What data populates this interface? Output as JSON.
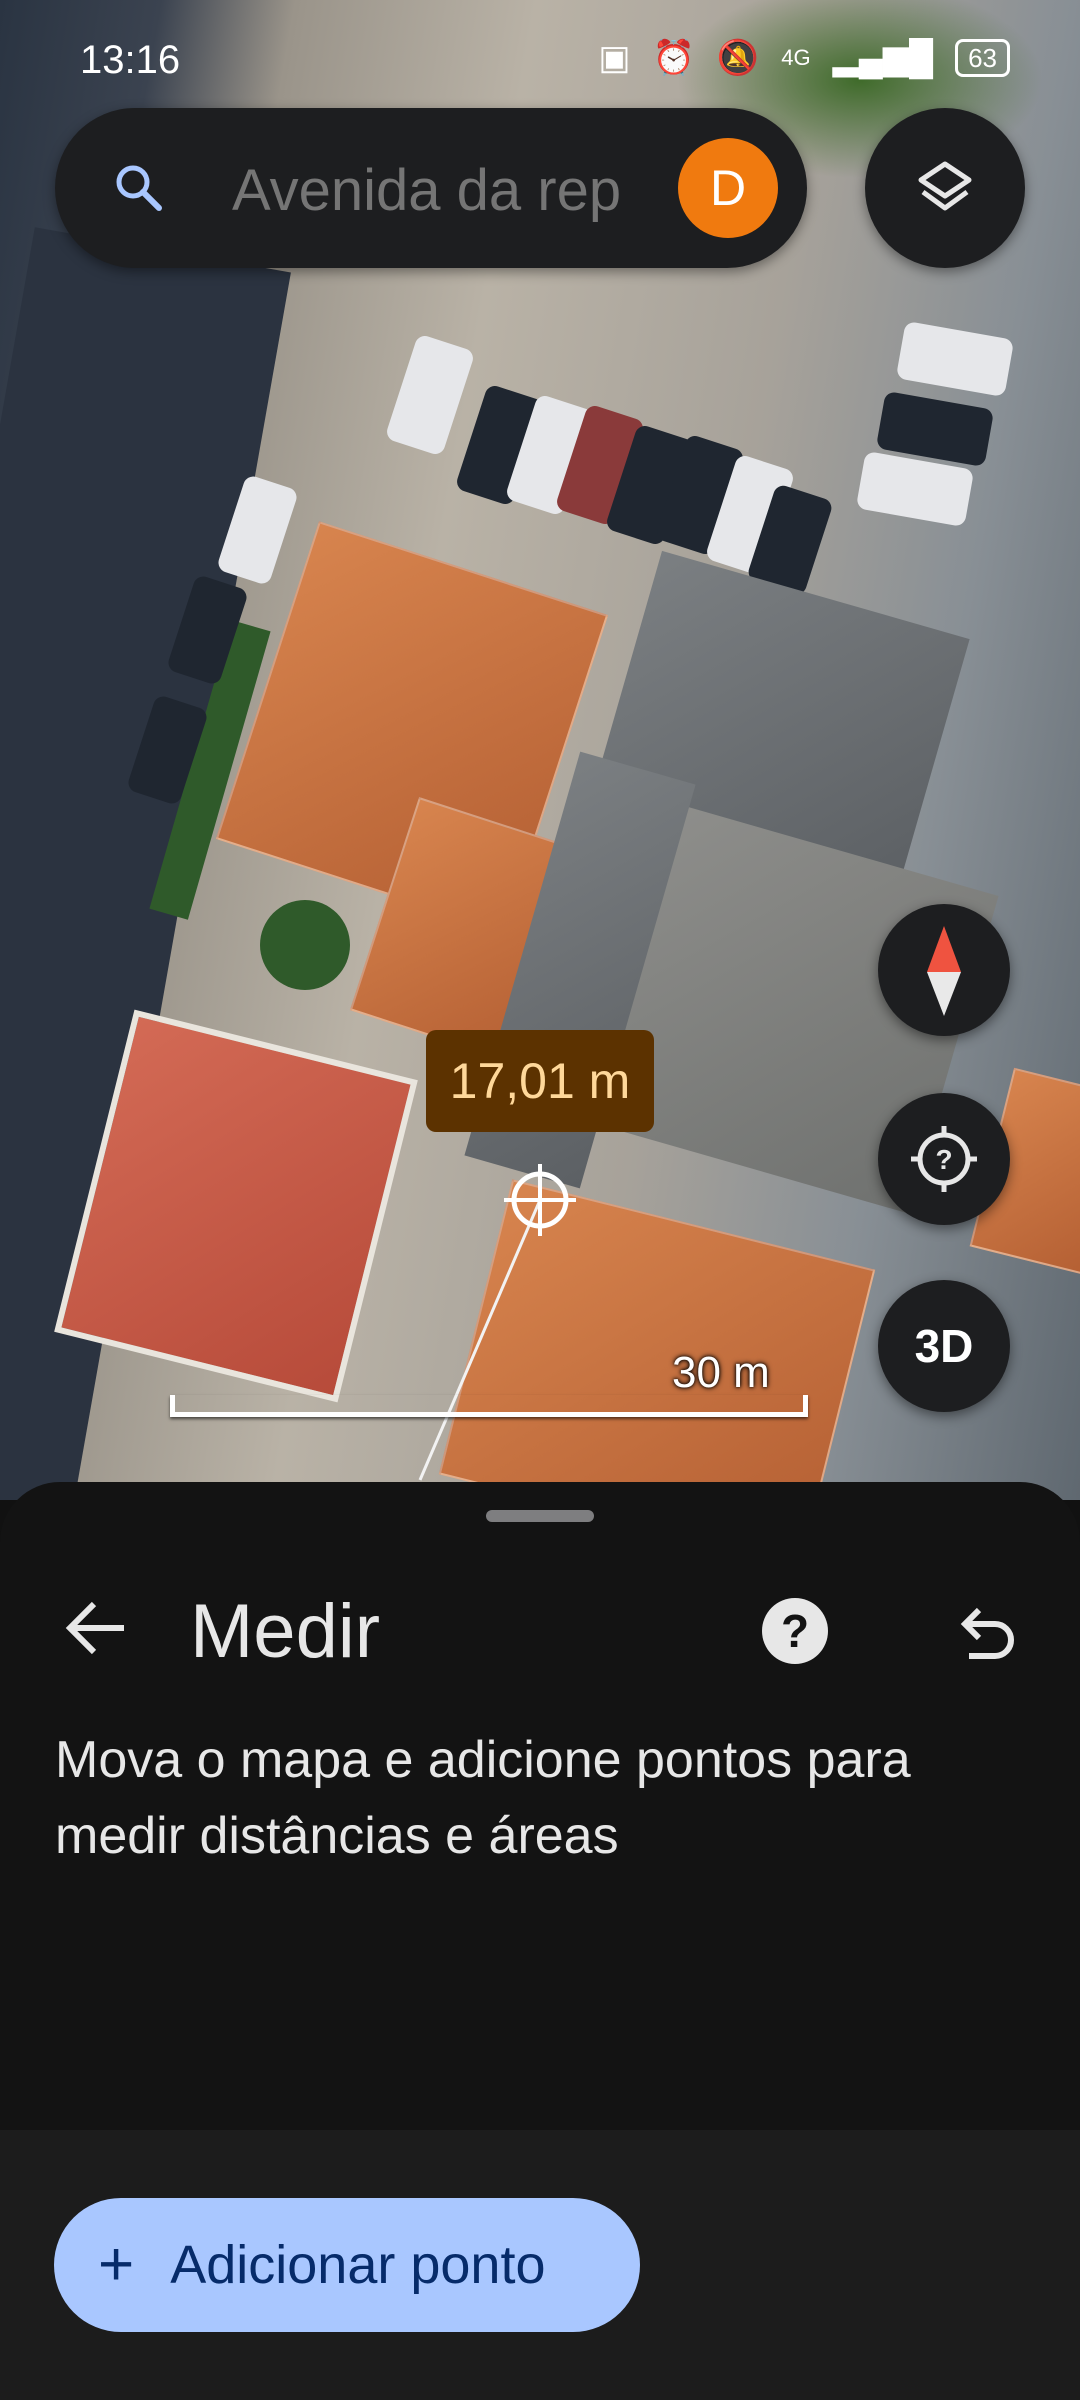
{
  "status_bar": {
    "time": "13:16",
    "network": "4G",
    "battery": "63"
  },
  "search": {
    "placeholder": "Avenida da rep",
    "avatar_initial": "D"
  },
  "map": {
    "measurement": "17,01 m",
    "scale_label": "30 m",
    "button_3d": "3D"
  },
  "sheet": {
    "title": "Medir",
    "description": "Mova o mapa e adicione pontos para medir distâncias e áreas",
    "help_symbol": "?"
  },
  "bottom": {
    "add_point_plus": "+",
    "add_point_label": "Adicionar ponto"
  },
  "colors": {
    "avatar": "#f07a0f",
    "add_point_bg": "#a9c7ff",
    "measure_label_bg": "#5c3200"
  }
}
